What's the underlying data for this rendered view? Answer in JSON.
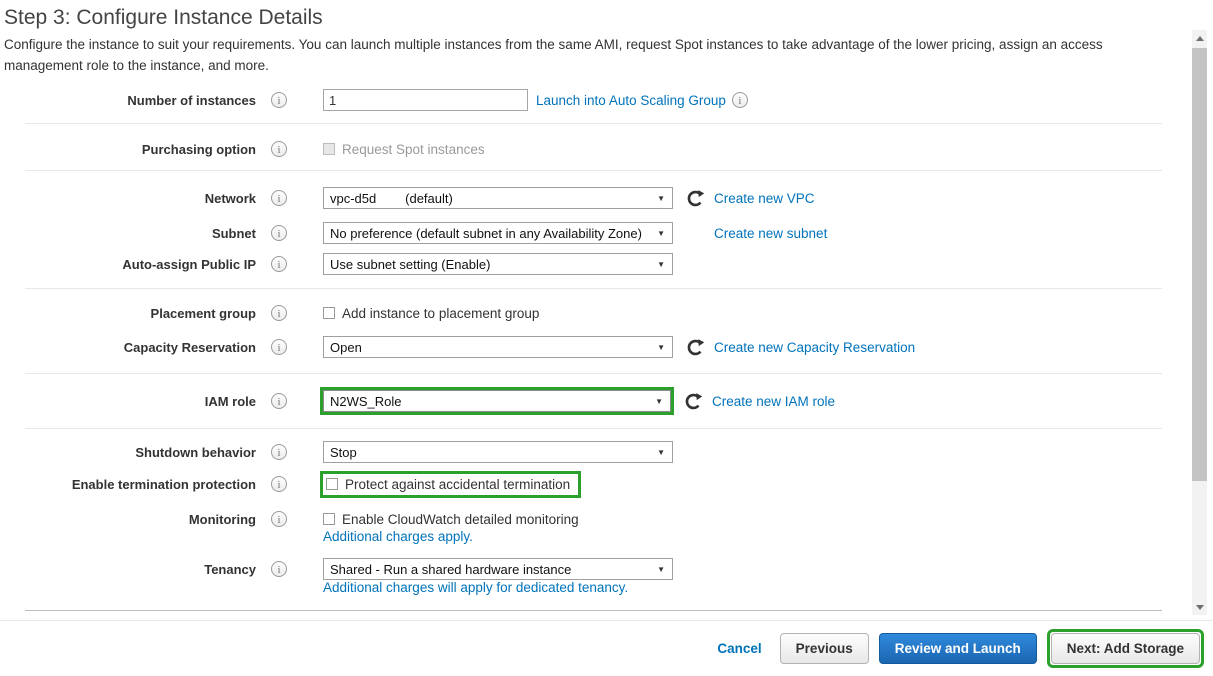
{
  "page": {
    "title": "Step 3: Configure Instance Details",
    "description": "Configure the instance to suit your requirements. You can launch multiple instances from the same AMI, request Spot instances to take advantage of the lower pricing, assign an access management role to the instance, and more."
  },
  "colors": {
    "link_blue": "#0073bb",
    "highlight_green": "#2ca02c",
    "primary_button_blue": "#1f7cd6",
    "label_text": "#333333"
  },
  "form": {
    "rows": {
      "instances": {
        "label": "Number of instances",
        "value": "1",
        "link": "Launch into Auto Scaling Group"
      },
      "purchasing": {
        "label": "Purchasing option",
        "checkbox_label": "Request Spot instances"
      },
      "network": {
        "label": "Network",
        "value": "vpc-d5d        (default)",
        "link": "Create new VPC"
      },
      "subnet": {
        "label": "Subnet",
        "value": "No preference (default subnet in any Availability Zone)",
        "link": "Create new subnet"
      },
      "public_ip": {
        "label": "Auto-assign Public IP",
        "value": "Use subnet setting (Enable)"
      },
      "placement": {
        "label": "Placement group",
        "checkbox_label": "Add instance to placement group"
      },
      "capacity": {
        "label": "Capacity Reservation",
        "value": "Open",
        "link": "Create new Capacity Reservation"
      },
      "iam": {
        "label": "IAM role",
        "value": "N2WS_Role",
        "link": "Create new IAM role"
      },
      "shutdown": {
        "label": "Shutdown behavior",
        "value": "Stop"
      },
      "termination": {
        "label": "Enable termination protection",
        "checkbox_label": "Protect against accidental termination"
      },
      "monitoring": {
        "label": "Monitoring",
        "checkbox_label": "Enable CloudWatch detailed monitoring",
        "note": "Additional charges apply."
      },
      "tenancy": {
        "label": "Tenancy",
        "value": "Shared - Run a shared hardware instance",
        "note": "Additional charges will apply for dedicated tenancy."
      }
    }
  },
  "footer": {
    "cancel": "Cancel",
    "previous": "Previous",
    "review_and_launch": "Review and Launch",
    "next": "Next: Add Storage"
  }
}
